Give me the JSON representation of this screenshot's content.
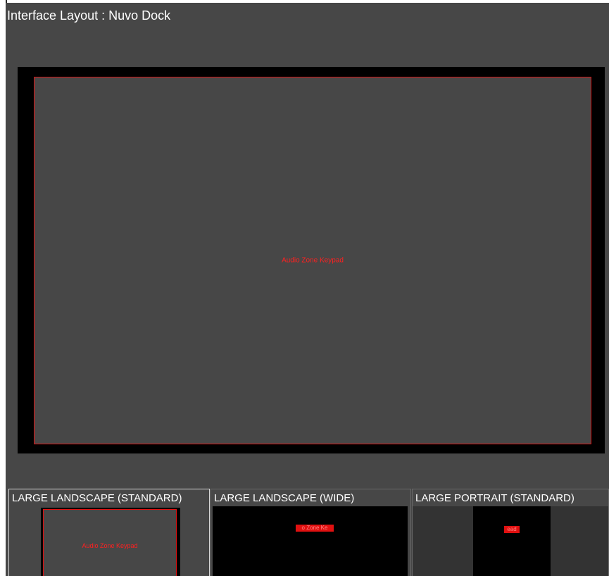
{
  "window": {
    "title": "Interface Layout : Nuvo Dock"
  },
  "preview": {
    "panel_label": "Audio Zone Keypad"
  },
  "layouts": [
    {
      "label": "LARGE LANDSCAPE (STANDARD)",
      "selected": true,
      "thumb_label": "Audio Zone Keypad"
    },
    {
      "label": "LARGE LANDSCAPE (WIDE)",
      "selected": false,
      "thumb_label": "o Zone Ke"
    },
    {
      "label": "LARGE PORTRAIT (STANDARD)",
      "selected": false,
      "thumb_label": "ead"
    }
  ],
  "colors": {
    "background": "#474747",
    "frame": "#000000",
    "accent": "#e01010",
    "text": "#ffffff"
  }
}
